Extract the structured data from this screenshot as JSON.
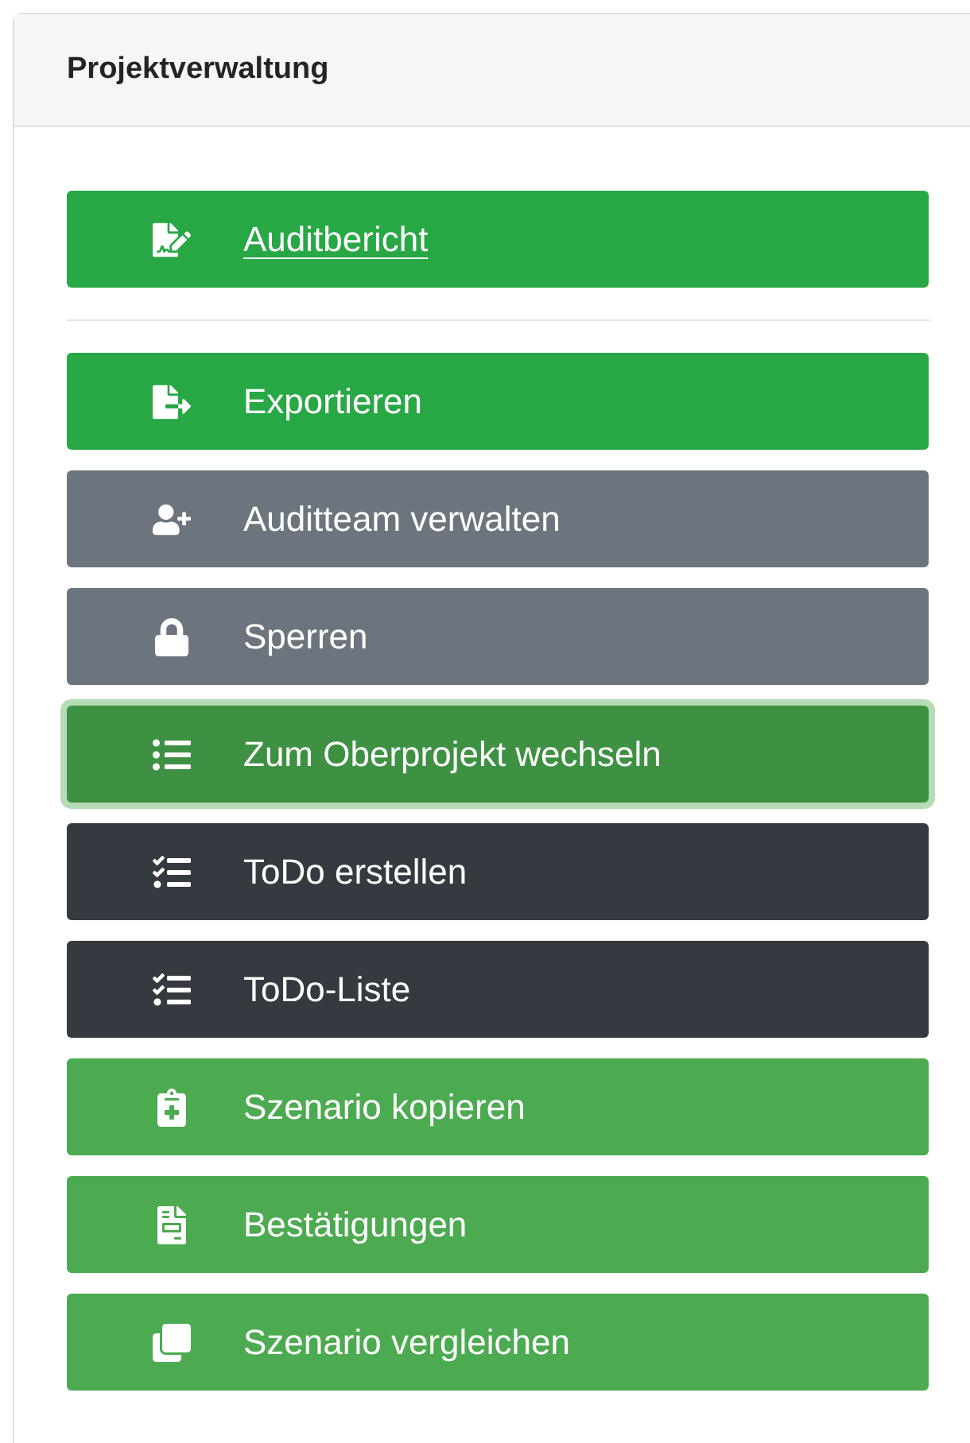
{
  "panel": {
    "title": "Projektverwaltung"
  },
  "groups": [
    [
      {
        "label": "Auditbericht",
        "color": "#28a745",
        "underlined": true,
        "focused": false
      }
    ],
    [
      {
        "label": "Exportieren",
        "color": "#28a745",
        "underlined": false,
        "focused": false
      },
      {
        "label": "Auditteam verwalten",
        "color": "#6c757d",
        "underlined": false,
        "focused": false
      },
      {
        "label": "Sperren",
        "color": "#6c757d",
        "underlined": false,
        "focused": false
      },
      {
        "label": "Zum Oberprojekt wechseln",
        "color": "#3e9142",
        "underlined": false,
        "focused": true
      },
      {
        "label": "ToDo erstellen",
        "color": "#343a40",
        "underlined": false,
        "focused": false
      },
      {
        "label": "ToDo-Liste",
        "color": "#343a40",
        "underlined": false,
        "focused": false
      },
      {
        "label": "Szenario kopieren",
        "color": "#4caa50",
        "underlined": false,
        "focused": false
      },
      {
        "label": "Bestätigungen",
        "color": "#4caa50",
        "underlined": false,
        "focused": false
      },
      {
        "label": "Szenario vergleichen",
        "color": "#4caa50",
        "underlined": false,
        "focused": false
      }
    ]
  ]
}
